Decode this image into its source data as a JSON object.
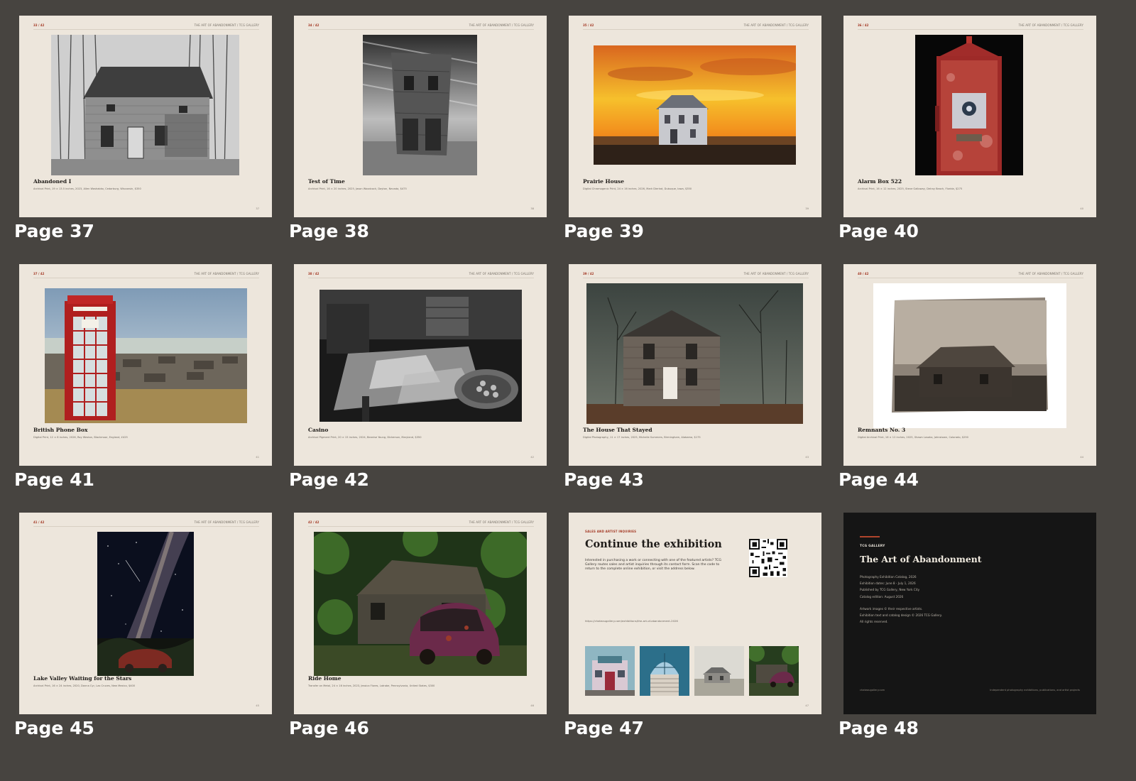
{
  "running_head": "THE ART OF ABANDONMENT  /  TCG GALLERY",
  "colors": {
    "background": "#474440",
    "page_paper": "#ede6dc",
    "accent": "#a43a26",
    "colophon_bg": "#151515"
  },
  "pages": [
    {
      "label": "Page 37",
      "counter": "33 / 42",
      "title": "Abandoned I",
      "detail": "Archival Print, 19 × 13.5 inches, 2023, Allen Washabko, Cedarburg, Wisconsin, $350",
      "folio": "37",
      "image": "bw-farmhouse"
    },
    {
      "label": "Page 38",
      "counter": "34 / 42",
      "title": "Test of Time",
      "detail": "Archival Print, 16 × 20 inches, 2025, Jason Woodcock, Dayton, Nevada, $475",
      "folio": "38",
      "image": "leaning-building"
    },
    {
      "label": "Page 39",
      "counter": "35 / 42",
      "title": "Prairie House",
      "detail": "Digital Chromogenic Print, 24 × 16 inches, 2026, Mark Dierkat, Dubuque, Iowa, $350",
      "folio": "39",
      "image": "sunset-house"
    },
    {
      "label": "Page 40",
      "counter": "36 / 42",
      "title": "Alarm Box 522",
      "detail": "Archival Print, 16 × 12 inches, 2025, Steve Galloway, Delray Beach, Florida, $275",
      "folio": "40",
      "image": "fire-alarm-box"
    },
    {
      "label": "Page 41",
      "counter": "37 / 42",
      "title": "British Phone Box",
      "detail": "Digital Print, 12 × 8 inches, 2026, Roy Weston, Blackmoor, England, £425",
      "folio": "41",
      "image": "red-phone-box"
    },
    {
      "label": "Page 42",
      "counter": "38 / 42",
      "title": "Casino",
      "detail": "Archival Pigment Print, 20 × 15 inches, 2024, Beanise Young, Dickerson, Maryland, $350",
      "folio": "42",
      "image": "casino-interior"
    },
    {
      "label": "Page 43",
      "counter": "39 / 42",
      "title": "The House That Stayed",
      "detail": "Digital Photography, 11 × 17 inches, 2025, Michelle Summers, Birmingham, Alabama, $175",
      "folio": "43",
      "image": "dark-house"
    },
    {
      "label": "Page 44",
      "counter": "40 / 42",
      "title": "Remnants No. 3",
      "detail": "Digital Archival Print, 16 × 12 inches, 2025, Shawn Losaka, Johnstown, Colorado, $250",
      "folio": "44",
      "image": "sepia-cabin"
    },
    {
      "label": "Page 45",
      "counter": "41 / 42",
      "title": "Lake Valley Waiting for the Stars",
      "detail": "Archival Print, 16 × 24 inches, 2020, Donna Cyr, Las Cruces, New Mexico, $400",
      "folio": "45",
      "image": "milky-way-car"
    },
    {
      "label": "Page 46",
      "counter": "42 / 42",
      "title": "Ride Home",
      "detail": "Transfer on Metal, 24 × 16 inches, 2023, Jessica Flores, Latrobe, Pennsylvania, United States, $300",
      "folio": "46",
      "image": "car-wreck-forest"
    }
  ],
  "closing": {
    "label": "Page 47",
    "eyebrow": "SALES AND ARTIST INQUIRIES",
    "title": "Continue the exhibition",
    "body": "Interested in purchasing a work or connecting with one of the featured artists? TCG Gallery routes sales and artist inquiries through its contact form. Scan the code to return to the complete online exhibition, or visit the address below.",
    "url": "https://chateaugallery.com/exhibitions/the-art-of-abandonment-2026",
    "folio": "47",
    "thumbnails": [
      "storefront-thumb",
      "blue-staircase-thumb",
      "farmhouse-thumb",
      "forest-car-thumb"
    ]
  },
  "colophon": {
    "label": "Page 48",
    "gallery": "TCG GALLERY",
    "title": "The Art of Abandonment",
    "lines": [
      "Photography Exhibition Catalog, 2026",
      "Exhibition dates: June 8 - July 1, 2026",
      "Published by TCG Gallery, New York City",
      "Catalog edition: August 2026"
    ],
    "rights": [
      "Artwork images © their respective artists.",
      "Exhibition text and catalog design © 2026 TCG Gallery.",
      "All rights reserved."
    ],
    "footer_left": "chateaugallery.com",
    "footer_right": "Independent photography exhibitions, publications, and artist projects"
  }
}
